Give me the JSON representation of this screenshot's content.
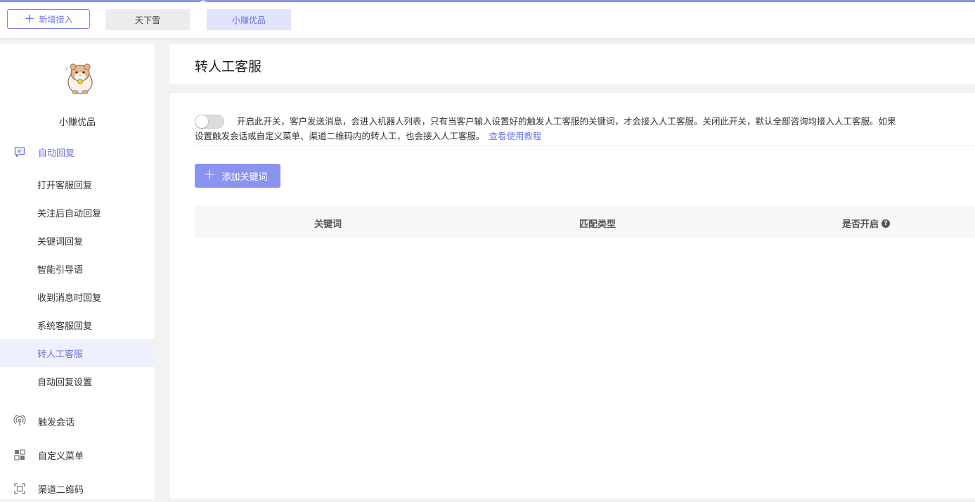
{
  "topbar": {
    "new_button_icon": "plus-icon",
    "new_button_label": "新增接入",
    "accounts": [
      {
        "label": "天下雪",
        "active": false
      },
      {
        "label": "小赚优品",
        "active": true
      }
    ]
  },
  "sidebar": {
    "shop_name": "小赚优品",
    "auto_reply": {
      "label": "自动回复",
      "icon": "message-square-icon",
      "items": [
        {
          "label": "打开客服回复"
        },
        {
          "label": "关注后自动回复"
        },
        {
          "label": "关键词回复"
        },
        {
          "label": "智能引导语"
        },
        {
          "label": "收到消息时回复"
        },
        {
          "label": "系统客服回复"
        },
        {
          "label": "转人工客服",
          "selected": true
        },
        {
          "label": "自动回复设置"
        }
      ]
    },
    "groups": [
      {
        "label": "触发会话",
        "icon": "broadcast-icon"
      },
      {
        "label": "自定义菜单",
        "icon": "grid-menu-icon"
      },
      {
        "label": "渠道二维码",
        "icon": "qrcode-frame-icon"
      }
    ]
  },
  "header": {
    "title": "转人工客服"
  },
  "content": {
    "switch_on": false,
    "description_line1": "开启此开关，客户发送消息，会进入机器人列表，只有当客户输入设置好的触发人工客服的关键词，才会接入人工客服。关闭此开关，默认全部咨询均接入人工客服。如果",
    "description_line2": "设置触发会话或自定义菜单、渠道二维码内的转人工，也会接入人工客服。",
    "tutorial_link": "查看使用教程",
    "add_button_label": "添加关键词",
    "table": {
      "columns": [
        "关键词",
        "匹配类型",
        "是否开启"
      ],
      "help_icon": "question-circle-icon",
      "rows": []
    }
  },
  "colors": {
    "accent": "#6b75e8",
    "accent_button": "#8a93f0"
  }
}
